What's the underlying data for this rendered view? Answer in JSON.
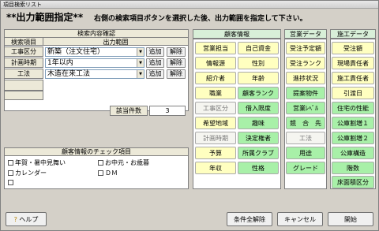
{
  "window": {
    "title": "項目検索リスト"
  },
  "heading": {
    "title": "**出力範囲指定**",
    "message": "右側の検索項目ボタンを選択した後、出力範囲を指定して下さい。"
  },
  "criteria": {
    "title": "検索内容確認",
    "col_item": "検索項目",
    "col_range": "出力範囲",
    "rows": [
      {
        "label": "工事区分",
        "value": "新築（注文住宅）",
        "add": "追加",
        "remove": "解除"
      },
      {
        "label": "計画時期",
        "value": "1年以内",
        "add": "追加",
        "remove": "解除"
      },
      {
        "label": "工法",
        "value": "木造在来工法",
        "add": "追加",
        "remove": "解除"
      }
    ]
  },
  "count": {
    "label": "該当件数",
    "value": "3"
  },
  "check": {
    "title": "顧客情報のチェック項目",
    "items": [
      {
        "label": "年賀・暑中見舞い"
      },
      {
        "label": "お中元・お歳暮"
      },
      {
        "label": "カレンダー"
      },
      {
        "label": "ＤＭ"
      },
      {
        "label": ""
      }
    ]
  },
  "columns": {
    "customer": {
      "title": "顧客情報",
      "left": [
        "営業担当",
        "情報源",
        "紹介者",
        "職業",
        "工事区分",
        "希望地域",
        "計画時期",
        "予算",
        "年収"
      ],
      "right": [
        "自己資金",
        "性別",
        "年齢",
        "顧客ランク",
        "借入限度",
        "趣味",
        "決定権者",
        "所属クラブ",
        "性格"
      ]
    },
    "sales": {
      "title": "営業データ",
      "items": [
        "受注予定額",
        "受注ランク",
        "進捗状況",
        "提案物件",
        "営業ﾚﾍﾞﾙ",
        "競　合　先",
        "工法",
        "用途",
        "グレード"
      ]
    },
    "construction": {
      "title": "施工データ",
      "items": [
        "受注額",
        "現場責任者",
        "施工責任者",
        "引渡日",
        "住宅の性能",
        "公庫割増１",
        "公庫割増２",
        "公庫構造",
        "階数",
        "床面積区分"
      ]
    }
  },
  "footer": {
    "help": "ヘルプ",
    "clear_all": "条件全解除",
    "cancel": "キャンセル",
    "open": "開始"
  }
}
